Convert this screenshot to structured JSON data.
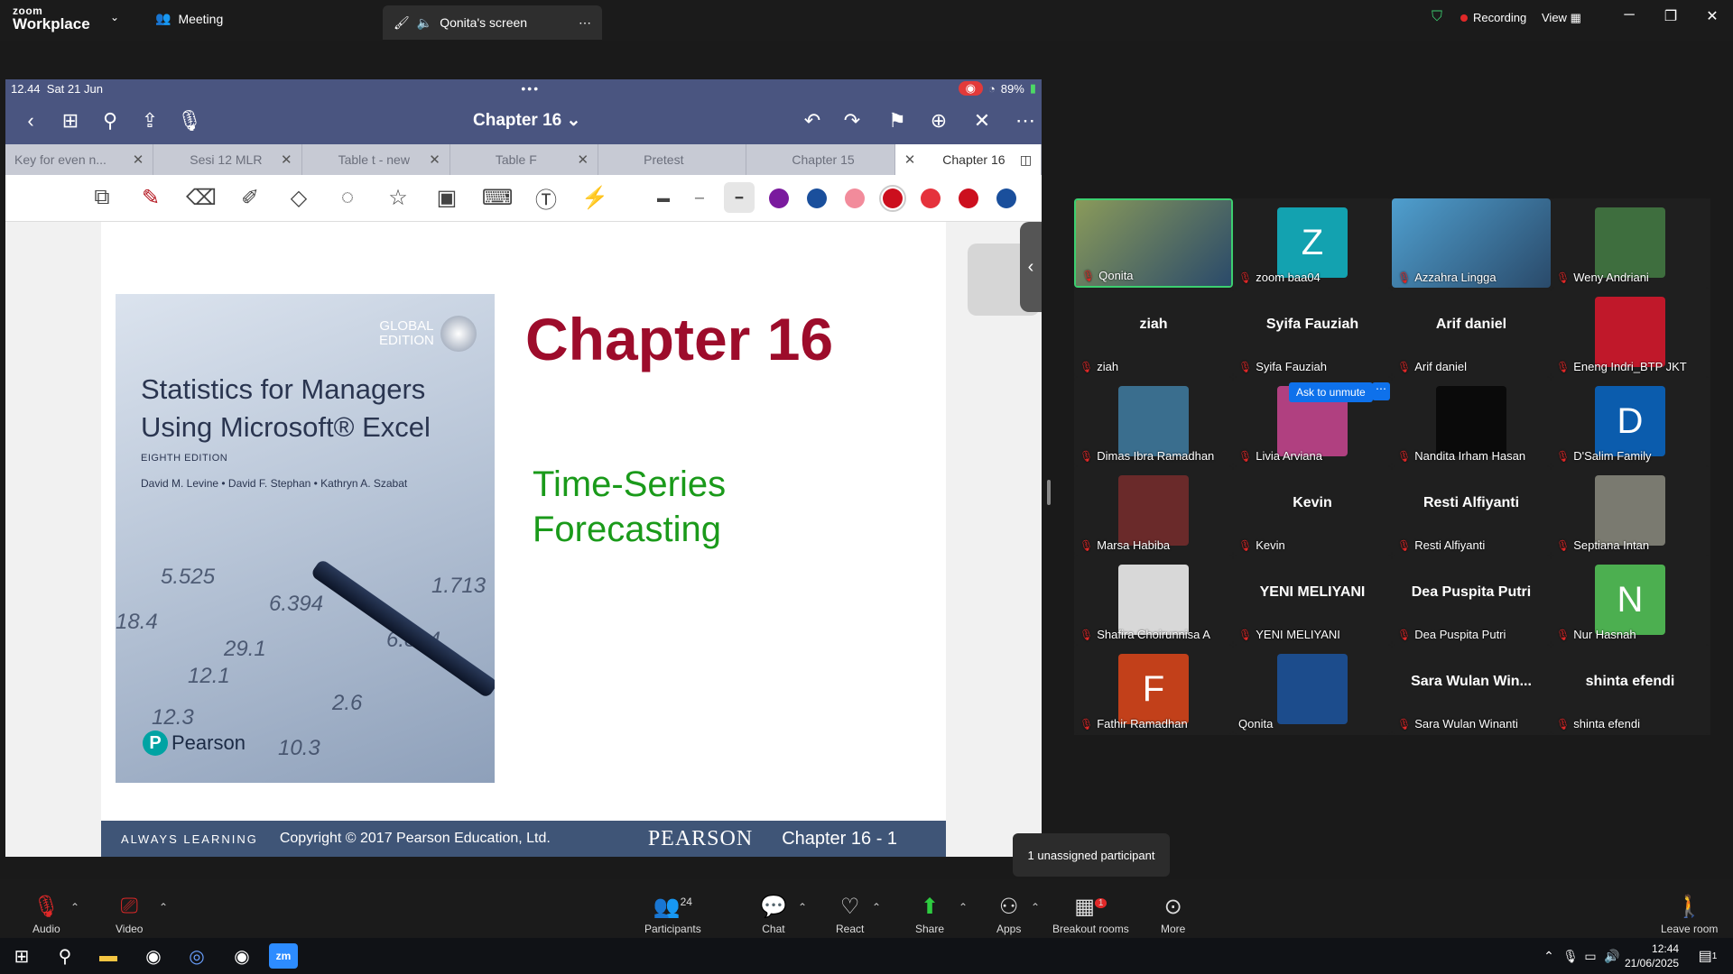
{
  "app": {
    "brand_top": "zoom",
    "brand_bottom": "Workplace",
    "meeting_label": "Meeting",
    "screen_tab": "Qonita's screen",
    "recording": "Recording",
    "view": "View"
  },
  "ipad": {
    "time": "12.44",
    "date": "Sat 21 Jun",
    "battery": "89%",
    "doc_title": "Chapter 16 ⌄",
    "tabs": [
      {
        "label": "Key for even n..."
      },
      {
        "label": "Sesi 12 MLR"
      },
      {
        "label": "Table t - new"
      },
      {
        "label": "Table F"
      },
      {
        "label": "Pretest"
      },
      {
        "label": "Chapter 15"
      },
      {
        "label": "Chapter 16"
      }
    ],
    "colors": [
      "#7a1a9e",
      "#1a4f9c",
      "#f28b9b",
      "#cc0f1e",
      "#e5323c",
      "#cc0f1e",
      "#1a4f9c"
    ]
  },
  "slide": {
    "chapter": "Chapter 16",
    "subtitle_line1": "Time-Series",
    "subtitle_line2": "Forecasting",
    "cover": {
      "edition_line1": "GLOBAL",
      "edition_line2": "EDITION",
      "title_line1": "Statistics for Managers",
      "title_line2": "Using Microsoft® Excel",
      "edition": "EIGHTH EDITION",
      "authors": "David M. Levine • David F. Stephan • Kathryn A. Szabat",
      "publisher": "Pearson",
      "numbers": [
        "5.525",
        "6.394",
        "1.713",
        "18.4",
        "29.1",
        "6.804",
        "12.1",
        "2.6",
        "12.3",
        "10.3"
      ]
    },
    "footer": {
      "tagline": "ALWAYS LEARNING",
      "copyright": "Copyright © 2017 Pearson Education, Ltd.",
      "brand": "PEARSON",
      "page": "Chapter 16 - 1"
    }
  },
  "gallery": {
    "participants": [
      {
        "name": "Qonita",
        "type": "video",
        "color": "#8a9a5a"
      },
      {
        "name": "zoom baa04",
        "type": "letter",
        "letter": "Z",
        "color": "#13a2b0"
      },
      {
        "name": "Azzahra Lingga",
        "type": "video",
        "color": "#4f9fcf"
      },
      {
        "name": "Weny Andriani",
        "type": "photo",
        "color": "#3e6e3e"
      },
      {
        "name": "ziah",
        "type": "text"
      },
      {
        "name": "Syifa Fauziah",
        "type": "text"
      },
      {
        "name": "Arif daniel",
        "type": "text"
      },
      {
        "name": "Eneng Indri_BTP JKT",
        "type": "photo",
        "color": "#c0182a"
      },
      {
        "name": "Dimas Ibra Ramadhan",
        "type": "photo",
        "color": "#3a6e8e"
      },
      {
        "name": "Livia Arviana",
        "type": "photo",
        "color": "#b04080"
      },
      {
        "name": "Nandita Irham Hasan",
        "type": "photo",
        "color": "#0a0a0a"
      },
      {
        "name": "D'Salim Family",
        "type": "letter",
        "letter": "D",
        "color": "#0b5cad"
      },
      {
        "name": "Marsa Habiba",
        "type": "photo",
        "color": "#6a2a2a"
      },
      {
        "name": "Kevin",
        "type": "text"
      },
      {
        "name": "Resti Alfiyanti",
        "type": "text"
      },
      {
        "name": "Septiana Intan",
        "type": "photo",
        "color": "#7a7a70"
      },
      {
        "name": "Shafira Choirunnisa A",
        "type": "photo",
        "color": "#d8d8d8"
      },
      {
        "name": "YENI MELIYANI",
        "type": "text"
      },
      {
        "name": "Dea Puspita Putri",
        "type": "text"
      },
      {
        "name": "Nur Hasnah",
        "type": "letter",
        "letter": "N",
        "color": "#4caf50"
      },
      {
        "name": "Fathir Ramadhan",
        "type": "letter",
        "letter": "F",
        "color": "#c2401a"
      },
      {
        "name": "Qonita",
        "type": "photo",
        "color": "#1c4c8c"
      },
      {
        "name": "Sara Wulan Winanti",
        "type": "text",
        "big": "Sara  Wulan  Win..."
      },
      {
        "name": "shinta efendi",
        "type": "text"
      }
    ],
    "ask_unmute": "Ask to unmute",
    "more_dots": "⋯"
  },
  "tooltip": "1 unassigned participant",
  "controls": {
    "audio": "Audio",
    "video": "Video",
    "participants": "Participants",
    "participants_count": "24",
    "chat": "Chat",
    "react": "React",
    "share": "Share",
    "apps": "Apps",
    "breakout": "Breakout rooms",
    "breakout_badge": "1",
    "more": "More",
    "leave": "Leave room"
  },
  "taskbar": {
    "time": "12:44",
    "date": "21/06/2025",
    "notif": "1"
  }
}
